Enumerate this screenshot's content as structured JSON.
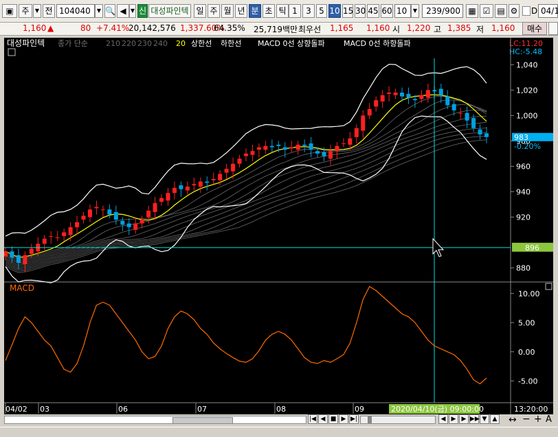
{
  "toolbar": {
    "market_label": "주",
    "period_label": "전",
    "code_value": "104040",
    "stock_badge": "신",
    "stock_name": "대성파인텍",
    "day_label": "일",
    "week_label": "주",
    "month_label": "월",
    "year_label": "년",
    "minute_label": "분",
    "second_label": "초",
    "tick_label": "틱",
    "intervals": [
      "1",
      "3",
      "5",
      "10",
      "15",
      "30",
      "45",
      "60"
    ],
    "interval_active": "10",
    "interval_select": "10",
    "count_value": "239",
    "count_total": "/900",
    "d_checkbox_label": "D",
    "date_value": "04/1"
  },
  "quote": {
    "price": "1,160",
    "change": "80",
    "change_pct": "+7.41%",
    "volume": "20,142,576",
    "volume_ratio": "1,337.60%",
    "turnover": "64.35%",
    "amount": "25,719백만",
    "best_ask_label": "최우선",
    "ask": "1,165",
    "bid": "1,160",
    "open_label": "시",
    "open": "1,220",
    "high_label": "고",
    "high": "1,385",
    "low_label": "저",
    "low": "1,160",
    "buy_button": "매수"
  },
  "colors": {
    "up": "#ff2020",
    "down": "#00a0e0",
    "ma": "#ffff00",
    "macd": "#ff6a00",
    "band": "#ffffff",
    "crosshair": "#00e0e0"
  },
  "chart": {
    "legend_name": "대성파인텍",
    "legend_ma_label": "종가 단순",
    "legend_ma_periods": [
      "210",
      "220",
      "230",
      "240"
    ],
    "legend_ma_active": "20",
    "legend_upper": "상한선",
    "legend_lower": "하한선",
    "legend_macd_up": "MACD 0선 상향돌파",
    "legend_macd_down": "MACD 0선 하향돌파",
    "lc_label": "LC:11.20",
    "hc_label": "HC:-5.48",
    "price_axis": [
      "1,040",
      "1,020",
      "1,000",
      "980",
      "960",
      "940",
      "920",
      "880"
    ],
    "current_price_tag": "983",
    "current_change_tag": "-0.20%",
    "crosshair_price_tag": "896",
    "macd_title": "MACD",
    "macd_axis": [
      "10.00",
      "5.00",
      "0.00",
      "-5.00"
    ],
    "date_axis": [
      "04/02",
      "03",
      "06",
      "07",
      "08",
      "09"
    ],
    "crosshair_date": "2020/04/10(금) 09:00:00",
    "time_label": "13:20:00"
  },
  "chart_data": {
    "type": "line",
    "title": "대성파인텍",
    "price_ylim": [
      870,
      1045
    ],
    "crosshair_price": 896,
    "current_price": 983,
    "close": [
      893,
      888,
      884,
      890,
      895,
      899,
      903,
      905,
      904,
      908,
      912,
      916,
      921,
      926,
      928,
      926,
      922,
      918,
      914,
      912,
      915,
      918,
      925,
      931,
      935,
      939,
      943,
      942,
      944,
      946,
      948,
      947,
      950,
      954,
      958,
      962,
      966,
      970,
      972,
      975,
      976,
      975,
      976,
      973,
      975,
      977,
      976,
      973,
      970,
      968,
      972,
      976,
      978,
      982,
      990,
      1000,
      1005,
      1012,
      1016,
      1018,
      1018,
      1015,
      1014,
      1012,
      1016,
      1020,
      1019,
      1016,
      1008,
      1004,
      1002,
      996,
      990,
      985,
      983
    ],
    "macd": [
      -1.5,
      1.2,
      4.0,
      6.0,
      5.0,
      3.5,
      2.0,
      1.0,
      -1.0,
      -3.0,
      -3.5,
      -2.0,
      1.0,
      5.0,
      8.0,
      8.5,
      8.0,
      6.5,
      5.0,
      3.5,
      2.0,
      0.0,
      -1.2,
      -0.8,
      1.0,
      4.0,
      6.0,
      7.0,
      6.5,
      5.5,
      4.0,
      3.0,
      1.5,
      0.5,
      -0.3,
      -1.0,
      -1.6,
      -1.8,
      -1.2,
      0.2,
      2.0,
      3.0,
      3.5,
      3.0,
      2.0,
      0.5,
      -1.0,
      -1.8,
      -2.0,
      -1.5,
      -1.8,
      -1.2,
      -0.5,
      1.5,
      5.0,
      9.0,
      11.2,
      10.5,
      9.5,
      8.5,
      7.5,
      6.5,
      6.0,
      5.0,
      3.5,
      2.0,
      1.0,
      0.5,
      0.0,
      -0.5,
      -1.5,
      -3.0,
      -4.8,
      -5.5,
      -4.5
    ],
    "macd_ylim": [
      -8.5,
      11.5
    ],
    "series": [
      {
        "name": "MACD",
        "values_ref": "macd"
      }
    ]
  },
  "scroll": {
    "left_arrow": "◀",
    "right_arrow": "▶",
    "minus": "−",
    "plus": "+",
    "a_label": "A"
  }
}
